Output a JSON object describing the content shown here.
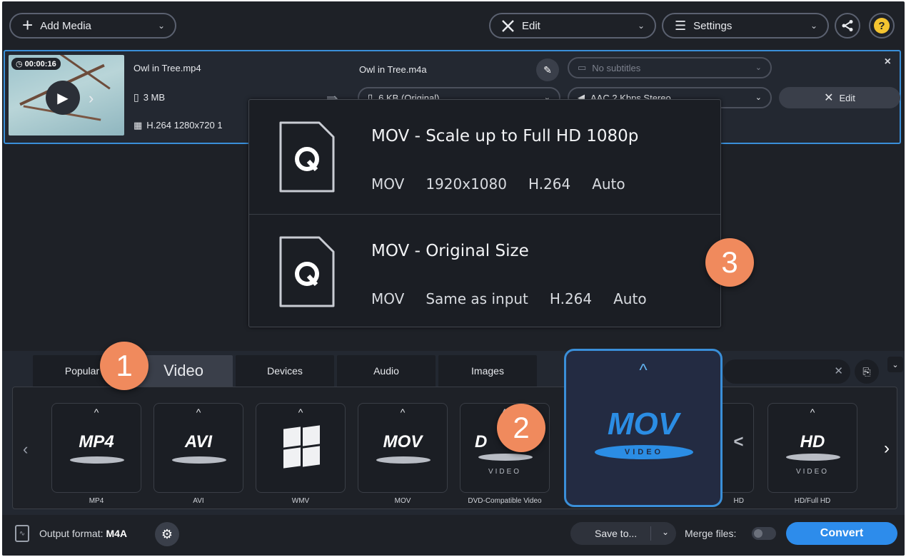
{
  "toolbar": {
    "add_media_label": "Add Media",
    "edit_label": "Edit",
    "settings_label": "Settings"
  },
  "file": {
    "timecode": "00:00:16",
    "source_name": "Owl in Tree.mp4",
    "source_size": "3 MB",
    "source_codec": "H.264 1280x720 1",
    "output_name": "Owl in Tree.m4a",
    "subtitles": "No subtitles",
    "output_size": "6 KB (Original)",
    "audio": "AAC 2 Kbps Stereo",
    "edit_label": "Edit"
  },
  "presets": [
    {
      "title": "MOV - Scale up to Full HD 1080p",
      "specs": [
        "MOV",
        "1920x1080",
        "H.264",
        "Auto"
      ]
    },
    {
      "title": "MOV - Original Size",
      "specs": [
        "MOV",
        "Same as input",
        "H.264",
        "Auto"
      ]
    }
  ],
  "callouts": [
    "1",
    "2",
    "3"
  ],
  "tabs": [
    "Popular",
    "Video",
    "Devices",
    "Audio",
    "Images"
  ],
  "active_tab": "Video",
  "formats": [
    {
      "logo": "MP4",
      "label": "MP4"
    },
    {
      "logo": "AVI",
      "label": "AVI"
    },
    {
      "logo": "",
      "label": "WMV"
    },
    {
      "logo": "MOV",
      "label": "MOV"
    },
    {
      "logo": "D",
      "label": "DVD-Compatible Video"
    },
    {
      "logo": "HD",
      "label": "HD/Full HD"
    }
  ],
  "hidden_label_fragment": "HD",
  "selected_format": {
    "logo": "MOV",
    "band": "VIDEO"
  },
  "video_word": "VIDEO",
  "bottom": {
    "output_format_label": "Output format:",
    "output_format_value": "M4A",
    "save_to_label": "Save to...",
    "merge_label": "Merge files:",
    "convert_label": "Convert"
  },
  "colors": {
    "accent": "#2d8ceb",
    "callout": "#f08a5d",
    "selection_border": "#3a8fd9"
  }
}
